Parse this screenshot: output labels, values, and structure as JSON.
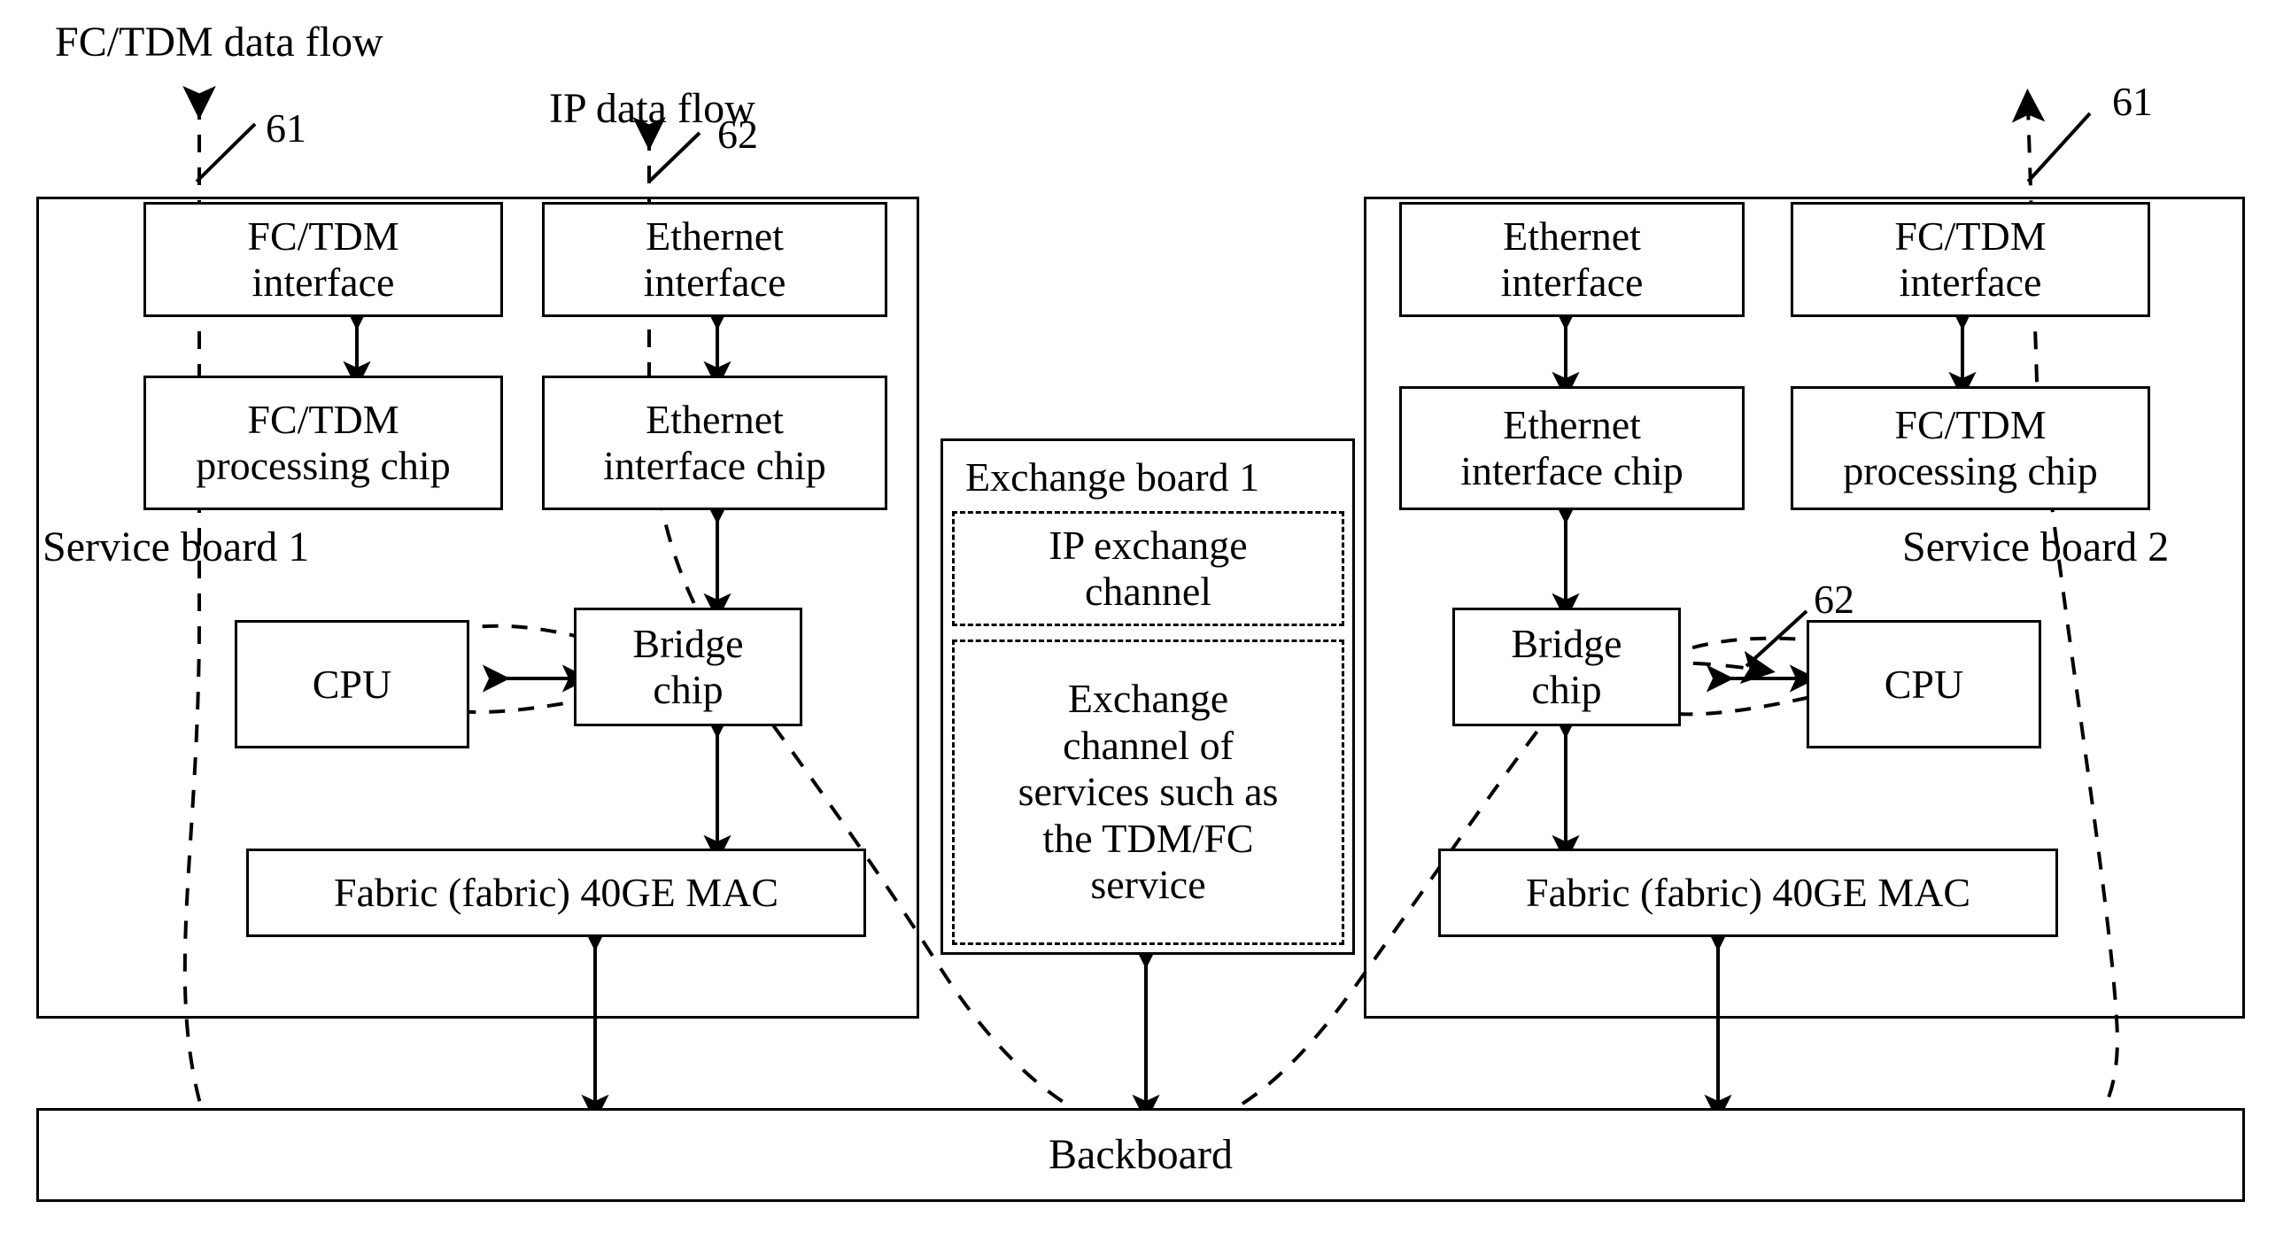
{
  "diagram": {
    "title": "Service board / exchange board data flow architecture",
    "flow_labels": [
      {
        "id": "fc_tdm_flow",
        "text": "FC/TDM data flow"
      },
      {
        "id": "ip_flow",
        "text": "IP data flow"
      }
    ],
    "reference_numerals": [
      {
        "id": "ref_61_left",
        "text": "61"
      },
      {
        "id": "ref_62_left",
        "text": "62"
      },
      {
        "id": "ref_61_right",
        "text": "61"
      },
      {
        "id": "ref_62_right",
        "text": "62"
      }
    ],
    "service_board_1": {
      "label": "Service board 1",
      "blocks": [
        {
          "id": "fc_tdm_interface",
          "text": "FC/TDM\ninterface"
        },
        {
          "id": "ethernet_interface",
          "text": "Ethernet\ninterface"
        },
        {
          "id": "fc_tdm_processing_chip",
          "text": "FC/TDM\nprocessing chip"
        },
        {
          "id": "ethernet_interface_chip",
          "text": "Ethernet\ninterface chip"
        },
        {
          "id": "cpu",
          "text": "CPU"
        },
        {
          "id": "bridge_chip",
          "text": "Bridge\nchip"
        },
        {
          "id": "fabric_mac",
          "text": "Fabric (fabric) 40GE MAC"
        }
      ]
    },
    "exchange_board_1": {
      "label": "Exchange board 1",
      "channels": [
        {
          "id": "ip_exchange_channel",
          "text": "IP exchange\nchannel"
        },
        {
          "id": "tdm_fc_exchange_channel",
          "text": "Exchange\nchannel of\nservices such as\nthe TDM/FC\nservice"
        }
      ]
    },
    "service_board_2": {
      "label": "Service board 2",
      "blocks": [
        {
          "id": "ethernet_interface",
          "text": "Ethernet\ninterface"
        },
        {
          "id": "fc_tdm_interface",
          "text": "FC/TDM\ninterface"
        },
        {
          "id": "ethernet_interface_chip",
          "text": "Ethernet\ninterface chip"
        },
        {
          "id": "fc_tdm_processing_chip",
          "text": "FC/TDM\nprocessing chip"
        },
        {
          "id": "bridge_chip",
          "text": "Bridge\nchip"
        },
        {
          "id": "cpu",
          "text": "CPU"
        },
        {
          "id": "fabric_mac",
          "text": "Fabric (fabric) 40GE MAC"
        }
      ]
    },
    "backboard": {
      "label": "Backboard"
    },
    "colors": {
      "line": "#000000",
      "background": "#ffffff"
    }
  }
}
